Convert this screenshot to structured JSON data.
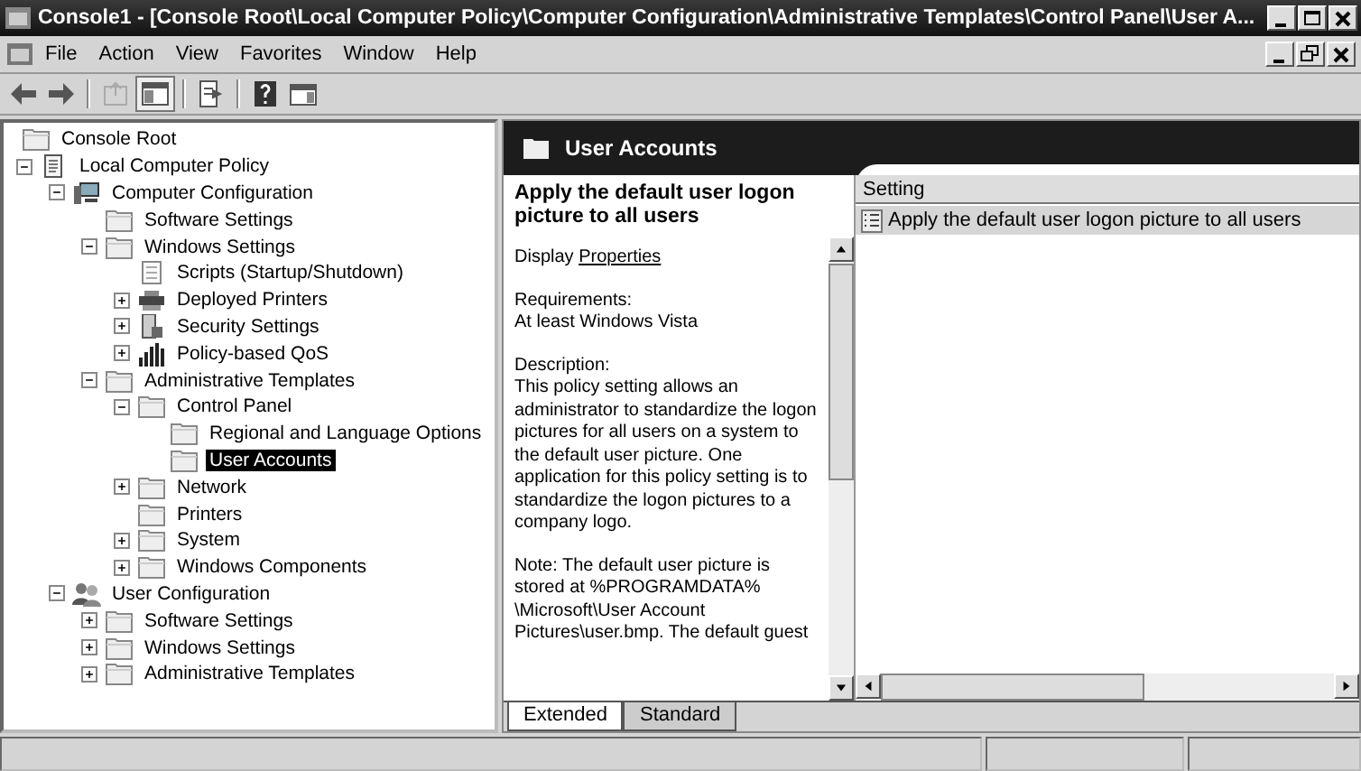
{
  "window": {
    "title": "Console1 - [Console Root\\Local Computer Policy\\Computer Configuration\\Administrative Templates\\Control Panel\\User A..."
  },
  "menu": [
    "File",
    "Action",
    "View",
    "Favorites",
    "Window",
    "Help"
  ],
  "toolbar": [
    {
      "kind": "back",
      "disabled": false,
      "pressed": false
    },
    {
      "kind": "forward",
      "disabled": false,
      "pressed": false
    },
    {
      "kind": "separator"
    },
    {
      "kind": "up",
      "disabled": true,
      "pressed": false
    },
    {
      "kind": "tree",
      "disabled": false,
      "pressed": true
    },
    {
      "kind": "separator"
    },
    {
      "kind": "export",
      "disabled": false,
      "pressed": false
    },
    {
      "kind": "separator"
    },
    {
      "kind": "help",
      "disabled": false,
      "pressed": false
    },
    {
      "kind": "actionpane",
      "disabled": false,
      "pressed": false
    }
  ],
  "tree": [
    {
      "label": "Console Root",
      "kind": "folder",
      "selected": false,
      "children": [
        {
          "label": "Local Computer Policy",
          "kind": "policy",
          "expanded": true,
          "selected": false,
          "children": [
            {
              "label": "Computer Configuration",
              "kind": "computer",
              "expanded": true,
              "selected": false,
              "children": [
                {
                  "label": "Software Settings",
                  "kind": "folder",
                  "selected": false
                },
                {
                  "label": "Windows Settings",
                  "kind": "folder",
                  "expanded": true,
                  "selected": false,
                  "children": [
                    {
                      "label": "Scripts (Startup/Shutdown)",
                      "kind": "script",
                      "selected": false
                    },
                    {
                      "label": "Deployed Printers",
                      "kind": "printer",
                      "expanded": false,
                      "selected": false
                    },
                    {
                      "label": "Security Settings",
                      "kind": "security",
                      "expanded": false,
                      "selected": false
                    },
                    {
                      "label": "Policy-based QoS",
                      "kind": "qos",
                      "expanded": false,
                      "selected": false
                    }
                  ]
                },
                {
                  "label": "Administrative Templates",
                  "kind": "folder",
                  "expanded": true,
                  "selected": false,
                  "children": [
                    {
                      "label": "Control Panel",
                      "kind": "folder",
                      "expanded": true,
                      "selected": false,
                      "children": [
                        {
                          "label": "Regional and Language Options",
                          "kind": "folder",
                          "selected": false
                        },
                        {
                          "label": "User Accounts",
                          "kind": "folder",
                          "selected": true
                        }
                      ]
                    },
                    {
                      "label": "Network",
                      "kind": "folder",
                      "expanded": false,
                      "selected": false
                    },
                    {
                      "label": "Printers",
                      "kind": "folder",
                      "selected": false
                    },
                    {
                      "label": "System",
                      "kind": "folder",
                      "expanded": false,
                      "selected": false
                    },
                    {
                      "label": "Windows Components",
                      "kind": "folder",
                      "expanded": false,
                      "selected": false
                    }
                  ]
                }
              ]
            },
            {
              "label": "User Configuration",
              "kind": "users",
              "expanded": true,
              "selected": false,
              "children": [
                {
                  "label": "Software Settings",
                  "kind": "folder",
                  "expanded": false,
                  "selected": false
                },
                {
                  "label": "Windows Settings",
                  "kind": "folder",
                  "expanded": false,
                  "selected": false
                },
                {
                  "label": "Administrative Templates",
                  "kind": "folder",
                  "expanded": false,
                  "selected": false
                }
              ]
            }
          ]
        }
      ]
    }
  ],
  "header": {
    "title": "User Accounts"
  },
  "description": {
    "title": "Apply the default user logon picture to all users",
    "display_label": "Display",
    "display_link": "Properties",
    "requirements_label": "Requirements:",
    "requirements": "At least Windows Vista",
    "description_label": "Description:",
    "description": "This policy setting allows an administrator to standardize the logon pictures for all users on a system to the default user picture. One application for this policy setting is to standardize the logon pictures to a company logo.",
    "note": "Note: The default user picture is stored at %PROGRAMDATA% \\Microsoft\\User Account Pictures\\user.bmp. The default guest"
  },
  "list": {
    "columns": [
      "Setting"
    ],
    "rows": [
      {
        "label": "Apply the default user logon picture to all users",
        "selected": true
      }
    ]
  },
  "tabs": [
    {
      "label": "Extended",
      "selected": true
    },
    {
      "label": "Standard",
      "selected": false
    }
  ]
}
